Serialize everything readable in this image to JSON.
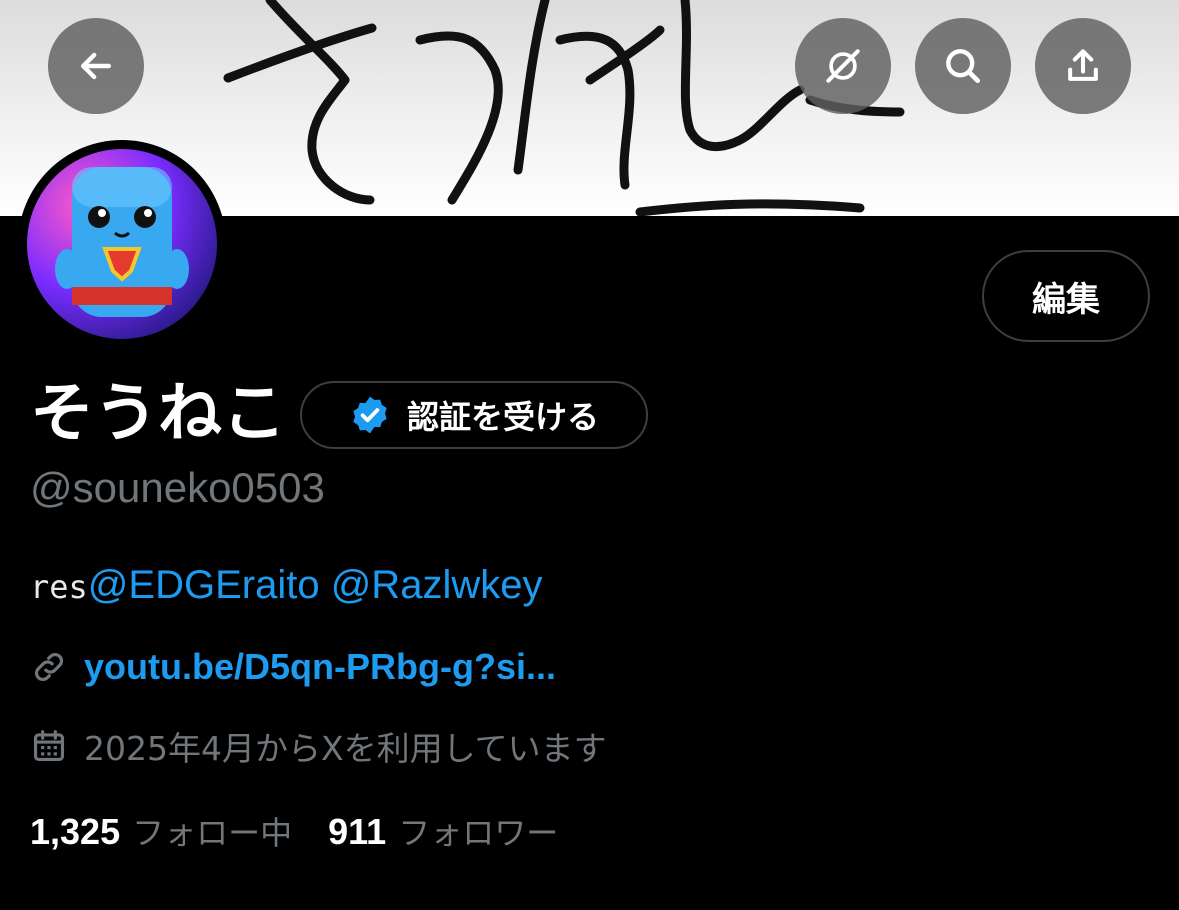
{
  "profile": {
    "display_name": "そうねこ",
    "handle": "@souneko0503",
    "bio_prefix": "res",
    "bio_mentions": [
      "@EDGEraito",
      "@Razlwkey"
    ],
    "link_text": "youtu.be/D5qn-PRbg-g?si...",
    "joined_text": "2025年4月からXを利用しています",
    "following_count": "1,325",
    "following_label": "フォロー中",
    "followers_count": "911",
    "followers_label": "フォロワー"
  },
  "buttons": {
    "edit_label": "編集",
    "verify_label": "認証を受ける"
  },
  "header_icons": [
    "back-arrow-icon",
    "grok-icon",
    "search-icon",
    "share-icon"
  ],
  "colors": {
    "background": "#000000",
    "link": "#1d9bf0",
    "muted": "#71767b",
    "verified_badge": "#1d9bf0"
  }
}
